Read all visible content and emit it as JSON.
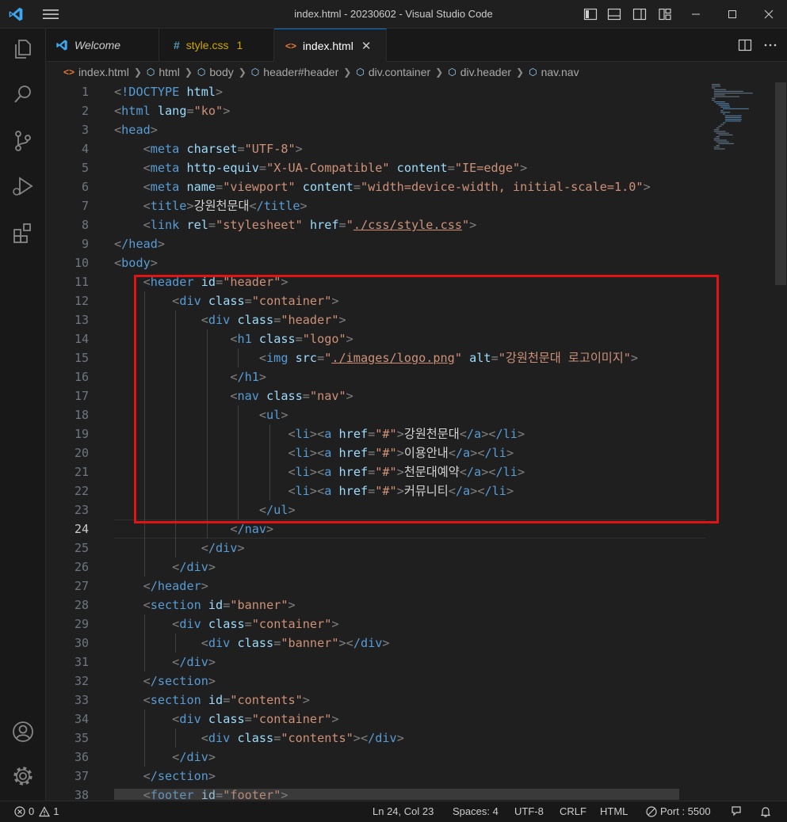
{
  "window": {
    "title": "index.html - 20230602 - Visual Studio Code"
  },
  "tabs": [
    {
      "label": "Welcome",
      "icon": "vscode-icon",
      "active": false
    },
    {
      "label": "style.css",
      "icon_text": "#",
      "badge": "1",
      "active": false
    },
    {
      "label": "index.html",
      "icon_text": "<>",
      "active": true
    }
  ],
  "breadcrumb": [
    {
      "label": "index.html",
      "glyph": "<>"
    },
    {
      "label": "html",
      "glyph": "⬡"
    },
    {
      "label": "body",
      "glyph": "⬡"
    },
    {
      "label": "header#header",
      "glyph": "⬡"
    },
    {
      "label": "div.container",
      "glyph": "⬡"
    },
    {
      "label": "div.header",
      "glyph": "⬡"
    },
    {
      "label": "nav.nav",
      "glyph": "⬡"
    }
  ],
  "editor": {
    "current_line": 24,
    "line_numbers": [
      "1",
      "2",
      "3",
      "4",
      "5",
      "6",
      "7",
      "8",
      "9",
      "10",
      "11",
      "12",
      "13",
      "14",
      "15",
      "16",
      "17",
      "18",
      "19",
      "20",
      "21",
      "22",
      "23",
      "24",
      "25",
      "26",
      "27",
      "28",
      "29",
      "30",
      "31",
      "32",
      "33",
      "34",
      "35",
      "36",
      "37",
      "38"
    ],
    "lines": [
      "<!DOCTYPE html>",
      "<html lang=\"ko\">",
      "<head>",
      "    <meta charset=\"UTF-8\">",
      "    <meta http-equiv=\"X-UA-Compatible\" content=\"IE=edge\">",
      "    <meta name=\"viewport\" content=\"width=device-width, initial-scale=1.0\">",
      "    <title>강원천문대</title>",
      "    <link rel=\"stylesheet\" href=\"./css/style.css\">",
      "</head>",
      "<body>",
      "    <header id=\"header\">",
      "        <div class=\"container\">",
      "            <div class=\"header\">",
      "                <h1 class=\"logo\">",
      "                    <img src=\"./images/logo.png\" alt=\"강원천문대 로고이미지\">",
      "                </h1>",
      "                <nav class=\"nav\">",
      "                    <ul>",
      "                        <li><a href=\"#\">강원천문대</a></li>",
      "                        <li><a href=\"#\">이용안내</a></li>",
      "                        <li><a href=\"#\">천문대예약</a></li>",
      "                        <li><a href=\"#\">커뮤니티</a></li>",
      "                    </ul>",
      "                </nav>",
      "            </div>",
      "        </div>",
      "    </header>",
      "    <section id=\"banner\">",
      "        <div class=\"container\">",
      "            <div class=\"banner\"></div>",
      "        </div>",
      "    </section>",
      "    <section id=\"contents\">",
      "        <div class=\"container\">",
      "            <div class=\"contents\"></div>",
      "        </div>",
      "    </section>",
      "    <footer id=\"footer\">"
    ]
  },
  "statusbar": {
    "errors": "0",
    "warnings": "1",
    "position": "Ln 24, Col 23",
    "spaces": "Spaces: 4",
    "encoding": "UTF-8",
    "eol": "CRLF",
    "language": "HTML",
    "port": "Port : 5500"
  },
  "colors": {
    "accent": "#0078d4",
    "highlight_box": "#e01414",
    "warning": "#cca700"
  }
}
